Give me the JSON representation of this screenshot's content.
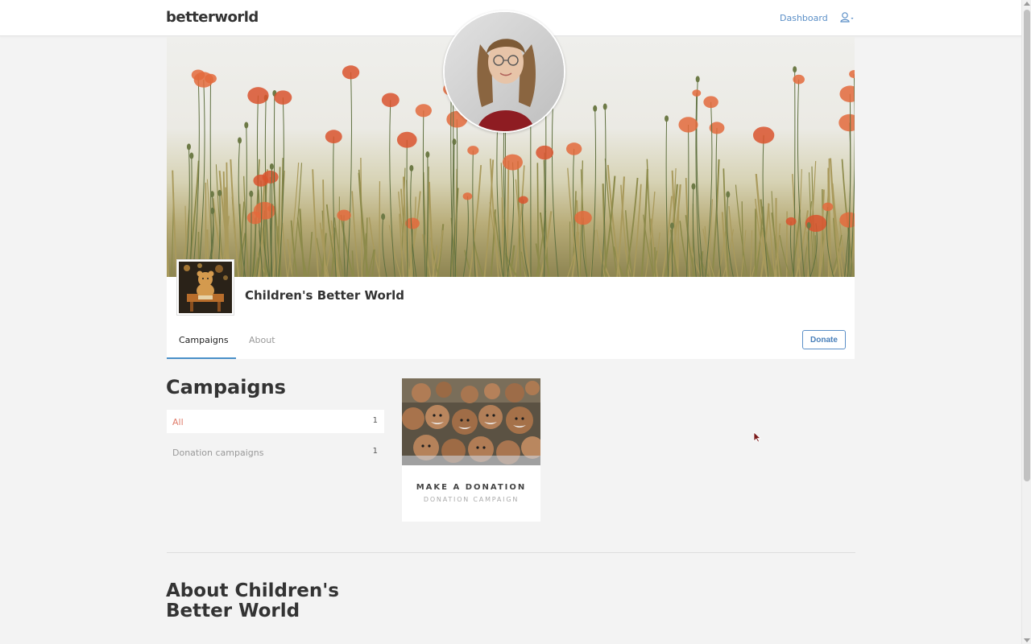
{
  "header": {
    "logo": "betterworld",
    "nav_dashboard": "Dashboard",
    "user_menu_icon": "user-icon"
  },
  "profile": {
    "name": "Children's Better World",
    "tabs": [
      {
        "label": "Campaigns",
        "active": true
      },
      {
        "label": "About",
        "active": false
      }
    ],
    "donate_label": "Donate"
  },
  "campaigns": {
    "heading": "Campaigns",
    "filters": [
      {
        "label": "All",
        "count": "1",
        "active": true
      },
      {
        "label": "Donation campaigns",
        "count": "1",
        "active": false
      }
    ],
    "cards": [
      {
        "title": "MAKE A DONATION",
        "subtitle": "DONATION CAMPAIGN"
      }
    ]
  },
  "about": {
    "heading": "About Children's Better World"
  },
  "colors": {
    "accent_blue": "#4a90c8",
    "link_blue": "#5b8fc7",
    "active_filter": "#e07b6a",
    "background": "#f3f3f3"
  }
}
